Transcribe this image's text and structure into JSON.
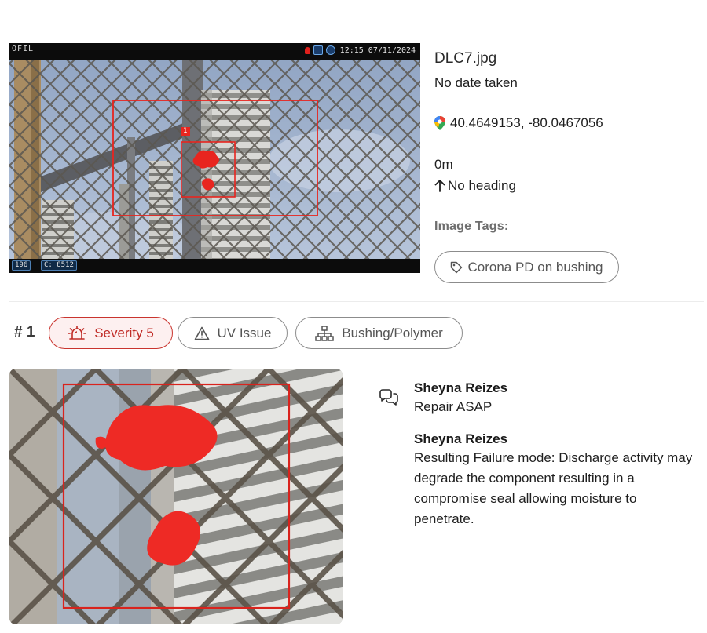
{
  "camera_overlay": {
    "logo": "OFIL",
    "timestamp": "12:15 07/11/2024",
    "gain_readout": "196",
    "count_readout": "C: 8512",
    "detection_index": "1"
  },
  "image_info": {
    "file_name": "DLC7.jpg",
    "date_taken": "No date taken",
    "location_icon": "map-pin-icon",
    "coordinates": "40.4649153, -80.0467056",
    "altitude": "0m",
    "heading_icon": "arrow-up-icon",
    "heading": "No heading",
    "tags_label": "Image Tags:",
    "tags": [
      {
        "icon": "tag-icon",
        "label": "Corona PD on bushing"
      }
    ]
  },
  "issue": {
    "number": "# 1",
    "severity": {
      "icon": "siren-icon",
      "label": "Severity 5",
      "color": "#c9342e"
    },
    "type": {
      "icon": "warning-triangle-icon",
      "label": "UV Issue"
    },
    "component": {
      "icon": "hierarchy-icon",
      "label": "Bushing/Polymer"
    }
  },
  "comments": [
    {
      "author": "Sheyna Reizes",
      "text": "Repair ASAP"
    },
    {
      "author": "Sheyna Reizes",
      "text": "Resulting Failure mode: Discharge activity may degrade the component resulting in a compromise seal allowing moisture to penetrate."
    }
  ],
  "colors": {
    "detection_red": "#e8251f",
    "severity_red": "#c9342e",
    "chip_border": "#8c8c8c"
  }
}
